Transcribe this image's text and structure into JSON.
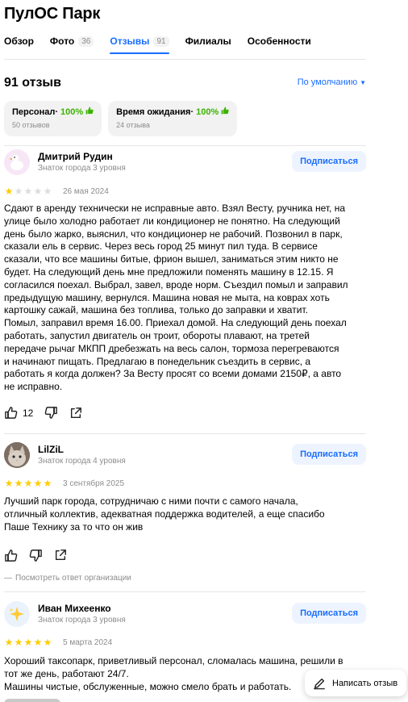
{
  "org": {
    "title": "ПулОС Парк"
  },
  "tabs": [
    {
      "label": "Обзор",
      "count": ""
    },
    {
      "label": "Фото",
      "count": "36"
    },
    {
      "label": "Отзывы",
      "count": "91"
    },
    {
      "label": "Филиалы",
      "count": ""
    },
    {
      "label": "Особенности",
      "count": ""
    }
  ],
  "reviews_header": {
    "count_label": "91 отзыв",
    "sort_label": "По умолчанию"
  },
  "aspects": [
    {
      "name": "Персонал",
      "separator": " · ",
      "percent": "100%",
      "sub": "50 отзывов"
    },
    {
      "name": "Время ожидания",
      "separator": " · ",
      "percent": "100%",
      "sub": "24 отзыва"
    }
  ],
  "reviews": [
    {
      "author": "Дмитрий Рудин",
      "level": "Знаток города 3 уровня",
      "subscribe": "Подписаться",
      "rating": 1,
      "date": "26 мая 2024",
      "text": "Сдают в аренду технически не исправные авто. Взял Весту, ручника нет, на\nулице было холодно работает ли кондиционер не понятно. На следующий\nдень было жарко, выяснил, что кондиционер не рабочий. Позвонил в парк,\nсказали ель в сервис. Через весь город 25 минут пил туда. В сервисе\nсказали, что все машины битые, фрион вышел, заниматься этим никто не\nбудет. На следующий день мне предложили поменять машину в 12.15. Я\nсогласился поехал. Выбрал, завел, вроде норм. Съездил помыл и заправил\nпредыдущую машину, вернулся. Машина новая не мыта, на коврах хоть\nкартошку сажай, машина без топлива, только до заправки и хватит.\nПомыл, заправил время 16.00. Приехал домой. На следующий день поехал\nработать, запустил двигатель он троит, обороты плавают, на третей\nпередаче рычаг МКПП дребезжать на весь салон, тормоза перегреваются\nи начинают пищать. Предлагаю в понедельник съездить в сервис, а\nработать я когда должен? За Весту просят со всеми домами 2150₽, а авто\nне исправно.",
      "likes": "12",
      "org_answer": ""
    },
    {
      "author": "LilZiL",
      "level": "Знаток города 4 уровня",
      "subscribe": "Подписаться",
      "rating": 5,
      "date": "3 сентября 2025",
      "text": "Лучший парк города, сотрудничаю с ними почти с самого начала,\nотличный коллектив, адекватная поддержка водителей, а еще спасибо\nПаше Технику за то что он жив",
      "likes": "",
      "org_answer": "Посмотреть ответ организации"
    },
    {
      "author": "Иван Михеенко",
      "level": "Знаток города 3 уровня",
      "subscribe": "Подписаться",
      "rating": 5,
      "date": "5 марта 2024",
      "text": "Хороший таксопарк, приветливый персонал, сломалась машина, решили в\nтот же день, работают 24/7.\nМашины чистые, обслуженные, можно смело брать и работать.",
      "likes": "",
      "org_answer": ""
    }
  ],
  "write_review": {
    "label": "Написать отзыв"
  },
  "colors": {
    "accent": "#196dff",
    "star": "#ffcc00",
    "positive": "#3bb300",
    "muted": "#8c8c8c"
  }
}
